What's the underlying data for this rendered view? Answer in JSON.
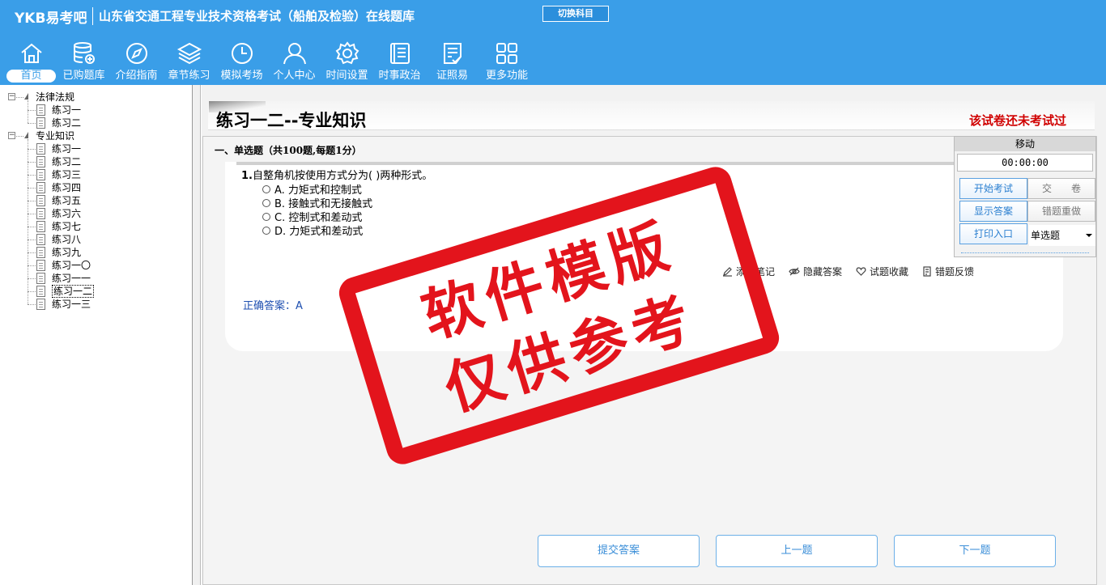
{
  "header": {
    "logo": "YKB易考吧",
    "title": "山东省交通工程专业技术资格考试（船舶及检验）在线题库",
    "switch_button": "切换科目"
  },
  "nav": [
    {
      "label": "首页",
      "icon": "home-icon"
    },
    {
      "label": "已购题库",
      "icon": "database-icon"
    },
    {
      "label": "介绍指南",
      "icon": "compass-icon"
    },
    {
      "label": "章节练习",
      "icon": "layers-icon"
    },
    {
      "label": "模拟考场",
      "icon": "clock-icon"
    },
    {
      "label": "个人中心",
      "icon": "user-icon"
    },
    {
      "label": "时间设置",
      "icon": "gear-icon"
    },
    {
      "label": "时事政治",
      "icon": "news-icon"
    },
    {
      "label": "证照易",
      "icon": "checklist-icon"
    },
    {
      "label": "更多功能",
      "icon": "grid-icon"
    }
  ],
  "tree": {
    "groups": [
      {
        "label": "法律法规",
        "items": [
          "练习一",
          "练习二"
        ]
      },
      {
        "label": "专业知识",
        "items": [
          "练习一",
          "练习二",
          "练习三",
          "练习四",
          "练习五",
          "练习六",
          "练习七",
          "练习八",
          "练习九",
          "练习一〇",
          "练习一一",
          "练习一二",
          "练习一三"
        ]
      }
    ],
    "selected": "练习一二"
  },
  "exam": {
    "title": "练习一二--专业知识",
    "status": "该试卷还未考试过",
    "section_heading": "一、单选题（共100题,每题1分）",
    "question_number": "1.",
    "question_text": "自整角机按使用方式分为( )两种形式。",
    "options": [
      "A. 力矩式和控制式",
      "B. 接触式和无接触式",
      "C. 控制式和差动式",
      "D. 力矩式和差动式"
    ],
    "actions": [
      "添加笔记",
      "隐藏答案",
      "试题收藏",
      "错题反馈"
    ],
    "answer_label": "正确答案：",
    "answer_value": "A"
  },
  "float_panel": {
    "move_label": "移动",
    "timer": "00:00:00",
    "start_exam": "开始考试",
    "submit_paper": "交　　卷",
    "show_answer": "显示答案",
    "redo_wrong": "错题重做",
    "print_entry": "打印入口",
    "question_type": "单选题"
  },
  "bottom": {
    "submit": "提交答案",
    "prev": "上一题",
    "next": "下一题"
  },
  "watermark": {
    "line1": "软件模版",
    "line2": "仅供参考"
  },
  "colors": {
    "header_bg": "#3a9ee8",
    "status_red": "#d00000",
    "stamp_red": "#e3141c",
    "answer_blue": "#1e4fb0"
  }
}
